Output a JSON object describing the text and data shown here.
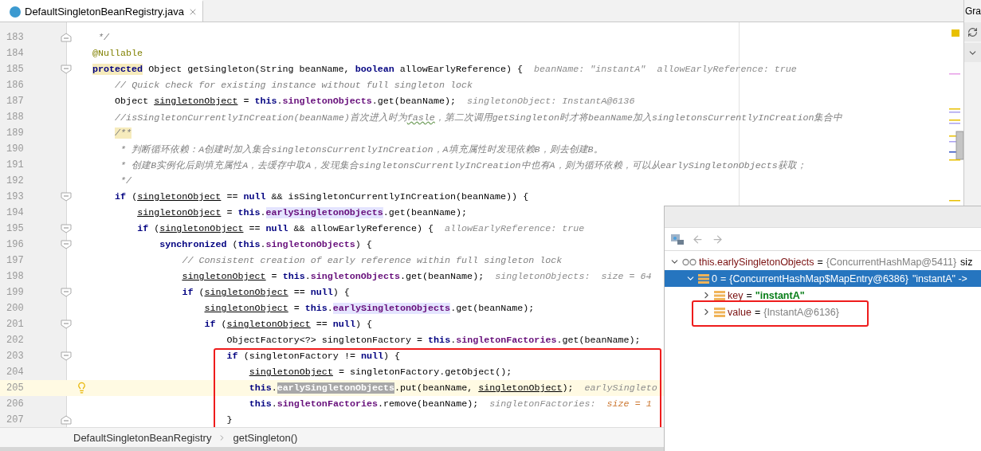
{
  "tab": {
    "title": "DefaultSingletonBeanRegistry.java",
    "selected": true
  },
  "right_panel": {
    "title": "Gra"
  },
  "code_lines": [
    {
      "number": "183",
      "fold_marker": true,
      "tokens": [
        {
          "kind": "comment",
          "text": " */"
        }
      ]
    },
    {
      "number": "184",
      "tokens": [
        {
          "kind": "annotation",
          "text": "@Nullable"
        }
      ]
    },
    {
      "number": "185",
      "fold_marker": true,
      "tokens": [
        {
          "kind": "kw-mark",
          "text": "protected"
        },
        {
          "kind": "plain",
          "text": " Object getSingleton(String beanName, "
        },
        {
          "kind": "kw",
          "text": "boolean"
        },
        {
          "kind": "plain",
          "text": " allowEarlyReference) {"
        }
      ],
      "hint": [
        {
          "kind": "hint",
          "text": "beanName: \"instantA\"  allowEarlyReference: true"
        }
      ],
      "children": [
        {
          "number": "186",
          "tokens": [
            {
              "kind": "comment",
              "text": "// Quick check for existing instance without full singleton lock"
            }
          ]
        },
        {
          "number": "187",
          "tokens": [
            {
              "kind": "plain",
              "text": "Object "
            },
            {
              "kind": "var",
              "text": "singletonObject"
            },
            {
              "kind": "plain",
              "text": " = "
            },
            {
              "kind": "kw",
              "text": "this"
            },
            {
              "kind": "plain",
              "text": "."
            },
            {
              "kind": "field",
              "text": "singletonObjects"
            },
            {
              "kind": "plain",
              "text": ".get(beanName);"
            }
          ],
          "hint": [
            {
              "kind": "hint",
              "text": "singletonObject: InstantA@6136"
            }
          ]
        },
        {
          "number": "188",
          "tokens": [
            {
              "kind": "comment",
              "text": "//isSingletonCurrentlyInCreation(beanName)首次进入时为"
            },
            {
              "kind": "typo",
              "text": "fasle"
            },
            {
              "kind": "comment",
              "text": "，第二次调用getSingleton时才将beanName加入singletonsCurrentlyInCreation集合中"
            }
          ]
        },
        {
          "number": "189",
          "tokens": [
            {
              "kind": "doc-mark",
              "text": "/**"
            }
          ]
        },
        {
          "number": "190",
          "tokens": [
            {
              "kind": "comment",
              "text": " * 判断循环依赖：A创建时加入集合singletonsCurrentlyInCreation，A填充属性时发现依赖B，则去创建B。"
            }
          ]
        },
        {
          "number": "191",
          "tokens": [
            {
              "kind": "comment",
              "text": " * 创建B实例化后则填充属性A，去缓存中取A，发现集合singletonsCurrentlyInCreation中也有A，则为循环依赖，可以从earlySingletonObjects获取；"
            }
          ]
        },
        {
          "number": "192",
          "tokens": [
            {
              "kind": "comment",
              "text": " */"
            }
          ]
        },
        {
          "number": "193",
          "fold_marker": true,
          "tokens": [
            {
              "kind": "kw",
              "text": "if"
            },
            {
              "kind": "plain",
              "text": " ("
            },
            {
              "kind": "var",
              "text": "singletonObject"
            },
            {
              "kind": "plain",
              "text": " == "
            },
            {
              "kind": "kw",
              "text": "null"
            },
            {
              "kind": "plain",
              "text": " && isSingletonCurrentlyInCreation(beanName)) {"
            }
          ],
          "children": [
            {
              "number": "194",
              "tokens": [
                {
                  "kind": "var",
                  "text": "singletonObject"
                },
                {
                  "kind": "plain",
                  "text": " = "
                },
                {
                  "kind": "kw",
                  "text": "this"
                },
                {
                  "kind": "plain",
                  "text": "."
                },
                {
                  "kind": "field-hl",
                  "text": "earlySingletonObjects"
                },
                {
                  "kind": "plain",
                  "text": ".get(beanName);"
                }
              ]
            },
            {
              "number": "195",
              "fold_marker": true,
              "tokens": [
                {
                  "kind": "kw",
                  "text": "if"
                },
                {
                  "kind": "plain",
                  "text": " ("
                },
                {
                  "kind": "var",
                  "text": "singletonObject"
                },
                {
                  "kind": "plain",
                  "text": " == "
                },
                {
                  "kind": "kw",
                  "text": "null"
                },
                {
                  "kind": "plain",
                  "text": " && allowEarlyReference) {"
                }
              ],
              "hint": [
                {
                  "kind": "hint",
                  "text": "allowEarlyReference: true"
                }
              ],
              "children": [
                {
                  "number": "196",
                  "fold_marker": true,
                  "tokens": [
                    {
                      "kind": "kw",
                      "text": "synchronized"
                    },
                    {
                      "kind": "plain",
                      "text": " ("
                    },
                    {
                      "kind": "kw",
                      "text": "this"
                    },
                    {
                      "kind": "plain",
                      "text": "."
                    },
                    {
                      "kind": "field",
                      "text": "singletonObjects"
                    },
                    {
                      "kind": "plain",
                      "text": ") {"
                    }
                  ],
                  "children": [
                    {
                      "number": "197",
                      "tokens": [
                        {
                          "kind": "comment",
                          "text": "// Consistent creation of early reference within full singleton lock"
                        }
                      ]
                    },
                    {
                      "number": "198",
                      "tokens": [
                        {
                          "kind": "var",
                          "text": "singletonObject"
                        },
                        {
                          "kind": "plain",
                          "text": " = "
                        },
                        {
                          "kind": "kw",
                          "text": "this"
                        },
                        {
                          "kind": "plain",
                          "text": "."
                        },
                        {
                          "kind": "field",
                          "text": "singletonObjects"
                        },
                        {
                          "kind": "plain",
                          "text": ".get(beanName);"
                        }
                      ],
                      "hint": [
                        {
                          "kind": "hint",
                          "text": "singletonObjects:  size = 64"
                        }
                      ]
                    },
                    {
                      "number": "199",
                      "fold_marker": true,
                      "tokens": [
                        {
                          "kind": "kw",
                          "text": "if"
                        },
                        {
                          "kind": "plain",
                          "text": " ("
                        },
                        {
                          "kind": "var",
                          "text": "singletonObject"
                        },
                        {
                          "kind": "plain",
                          "text": " == "
                        },
                        {
                          "kind": "kw",
                          "text": "null"
                        },
                        {
                          "kind": "plain",
                          "text": ") {"
                        }
                      ],
                      "children": [
                        {
                          "number": "200",
                          "tokens": [
                            {
                              "kind": "var",
                              "text": "singletonObject"
                            },
                            {
                              "kind": "plain",
                              "text": " = "
                            },
                            {
                              "kind": "kw",
                              "text": "this"
                            },
                            {
                              "kind": "plain",
                              "text": "."
                            },
                            {
                              "kind": "field-hl",
                              "text": "earlySingletonObjects"
                            },
                            {
                              "kind": "plain",
                              "text": ".get(beanName);"
                            }
                          ]
                        },
                        {
                          "number": "201",
                          "fold_marker": true,
                          "tokens": [
                            {
                              "kind": "kw",
                              "text": "if"
                            },
                            {
                              "kind": "plain",
                              "text": " ("
                            },
                            {
                              "kind": "var",
                              "text": "singletonObject"
                            },
                            {
                              "kind": "plain",
                              "text": " == "
                            },
                            {
                              "kind": "kw",
                              "text": "null"
                            },
                            {
                              "kind": "plain",
                              "text": ") {"
                            }
                          ],
                          "children": [
                            {
                              "number": "202",
                              "tokens": [
                                {
                                  "kind": "plain",
                                  "text": "ObjectFactory<?> singletonFactory = "
                                },
                                {
                                  "kind": "kw",
                                  "text": "this"
                                },
                                {
                                  "kind": "plain",
                                  "text": "."
                                },
                                {
                                  "kind": "field",
                                  "text": "singletonFactories"
                                },
                                {
                                  "kind": "plain",
                                  "text": ".get(beanName);"
                                }
                              ]
                            },
                            {
                              "number": "203",
                              "fold_marker": true,
                              "boxed": true,
                              "tokens": [
                                {
                                  "kind": "kw",
                                  "text": "if"
                                },
                                {
                                  "kind": "plain",
                                  "text": " (singletonFactory != "
                                },
                                {
                                  "kind": "kw",
                                  "text": "null"
                                },
                                {
                                  "kind": "plain",
                                  "text": ") {"
                                }
                              ],
                              "children": [
                                {
                                  "number": "204",
                                  "boxed": true,
                                  "tokens": [
                                    {
                                      "kind": "var",
                                      "text": "singletonObject"
                                    },
                                    {
                                      "kind": "plain",
                                      "text": " = singletonFactory.getObject();"
                                    }
                                  ]
                                },
                                {
                                  "number": "205",
                                  "current": true,
                                  "boxed": true,
                                  "tokens": [
                                    {
                                      "kind": "kw",
                                      "text": "this"
                                    },
                                    {
                                      "kind": "plain",
                                      "text": "."
                                    },
                                    {
                                      "kind": "field-sel",
                                      "text": "earlySingletonObjects"
                                    },
                                    {
                                      "kind": "plain",
                                      "text": ".put(beanName, "
                                    },
                                    {
                                      "kind": "var",
                                      "text": "singletonObject"
                                    },
                                    {
                                      "kind": "plain",
                                      "text": ");"
                                    }
                                  ],
                                  "hint": [
                                    {
                                      "kind": "hint",
                                      "text": "earlySingleto"
                                    }
                                  ]
                                },
                                {
                                  "number": "206",
                                  "boxed": true,
                                  "tokens": [
                                    {
                                      "kind": "kw",
                                      "text": "this"
                                    },
                                    {
                                      "kind": "plain",
                                      "text": "."
                                    },
                                    {
                                      "kind": "field",
                                      "text": "singletonFactories"
                                    },
                                    {
                                      "kind": "plain",
                                      "text": ".remove(beanName);"
                                    }
                                  ],
                                  "hint": [
                                    {
                                      "kind": "hint",
                                      "text": "singletonFactories:  "
                                    },
                                    {
                                      "kind": "hint-num",
                                      "text": "size = 1"
                                    }
                                  ]
                                }
                              ]
                            },
                            {
                              "number": "207",
                              "fold_marker": true,
                              "boxed": true,
                              "tokens": [
                                {
                                  "kind": "plain",
                                  "text": "}"
                                }
                              ]
                            }
                          ]
                        }
                      ]
                    }
                  ]
                }
              ]
            }
          ]
        }
      ]
    }
  ],
  "breadcrumbs": [
    "DefaultSingletonBeanRegistry",
    "getSingleton()"
  ],
  "debugger": {
    "nodes": [
      {
        "kind": "watch",
        "name": "this.earlySingletonObjects",
        "separator": "=",
        "value": "{ConcurrentHashMap@5411}",
        "value_is_string": false,
        "extra": "siz",
        "expanded": true,
        "selected": false,
        "children": [
          {
            "kind": "field",
            "name": "0",
            "separator": "=",
            "value": "{ConcurrentHashMap$MapEntry@6386}",
            "value_is_string": false,
            "extra": "\"instantA\" ->",
            "expanded": true,
            "selected": true,
            "children": [
              {
                "kind": "field",
                "name": "key",
                "separator": "=",
                "value": "\"instantA\"",
                "value_is_string": true,
                "expanded": false,
                "selected": false
              },
              {
                "kind": "field",
                "name": "value",
                "separator": "=",
                "value": "{InstantA@6136}",
                "value_is_string": false,
                "expanded": false,
                "selected": false,
                "boxed": true
              }
            ]
          }
        ]
      }
    ]
  }
}
